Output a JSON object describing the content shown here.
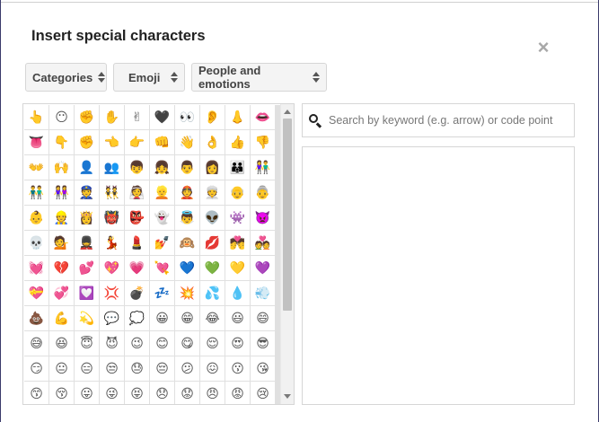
{
  "dialog": {
    "title": "Insert special characters",
    "close_label": "×"
  },
  "selects": {
    "category_type": "Categories",
    "category": "Emoji",
    "subcategory": "People and emotions"
  },
  "search": {
    "placeholder": "Search by keyword (e.g. arrow) or code point",
    "value": ""
  },
  "characters": [
    "👆",
    "😶",
    "✊",
    "✋",
    "✌",
    "🖤",
    "👀",
    "👂",
    "👃",
    "👄",
    "👅",
    "👇",
    "✊",
    "👈",
    "👉",
    "👊",
    "👋",
    "👌",
    "👍",
    "👎",
    "👐",
    "🙌",
    "👤",
    "👥",
    "👦",
    "👧",
    "👨",
    "👩",
    "👪",
    "👫",
    "👬",
    "👭",
    "👮",
    "👯",
    "👰",
    "👱",
    "👲",
    "👳",
    "👴",
    "👵",
    "👶",
    "👷",
    "👸",
    "👹",
    "👺",
    "👻",
    "👼",
    "👽",
    "👾",
    "👿",
    "💀",
    "💁",
    "💂",
    "💃",
    "💄",
    "💅",
    "🙉",
    "💋",
    "💏",
    "💑",
    "💓",
    "💔",
    "💕",
    "💖",
    "💗",
    "💘",
    "💙",
    "💚",
    "💛",
    "💜",
    "💝",
    "💞",
    "💟",
    "💢",
    "💣",
    "💤",
    "💥",
    "💦",
    "💧",
    "💨",
    "💩",
    "💪",
    "💫",
    "💬",
    "💭",
    "😀",
    "😁",
    "😂",
    "😃",
    "😄",
    "😅",
    "😆",
    "😇",
    "😈",
    "😉",
    "😊",
    "😋",
    "😌",
    "😍",
    "😎",
    "😏",
    "😐",
    "😑",
    "😒",
    "😓",
    "😔",
    "😕",
    "😖",
    "😗",
    "😘",
    "😙",
    "😚",
    "😛",
    "😜",
    "😝",
    "😞",
    "😟",
    "😠",
    "😡",
    "😢"
  ],
  "colors": {
    "text": "#222222",
    "border": "#d6d6d6",
    "select_bg": "#f4f4f4",
    "close": "#a8a8a8"
  }
}
